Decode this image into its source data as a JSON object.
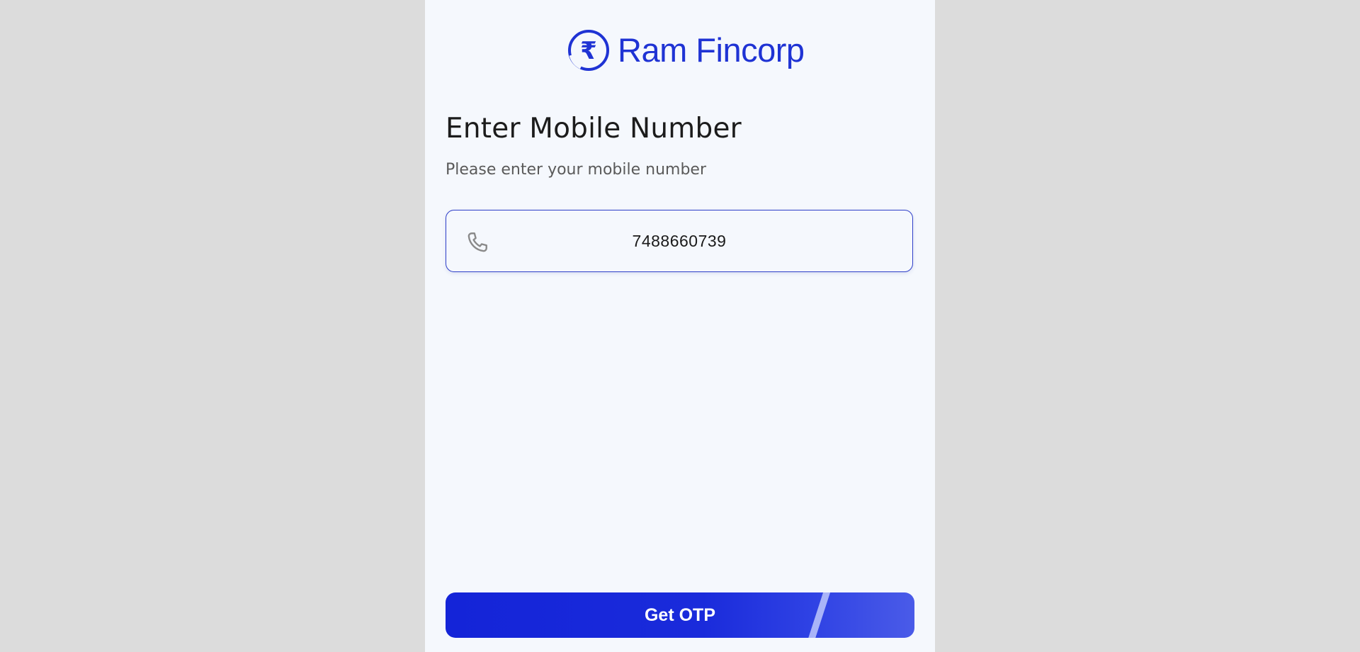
{
  "brand": {
    "name": "Ram Fincorp",
    "symbol": "₹",
    "color": "#1f33d4"
  },
  "page": {
    "title": "Enter Mobile Number",
    "subtitle": "Please enter your mobile number"
  },
  "phone_input": {
    "icon": "phone-icon",
    "value": "7488660739"
  },
  "actions": {
    "get_otp_label": "Get OTP",
    "button_color": "#1424d8"
  }
}
